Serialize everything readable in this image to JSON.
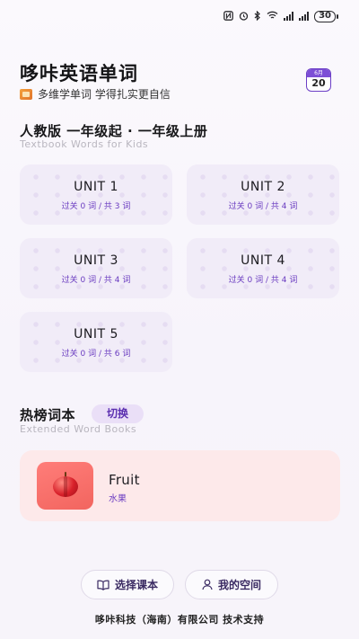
{
  "status_bar": {
    "battery": "30",
    "icons": [
      "nfc-icon",
      "alarm-icon",
      "bluetooth-icon",
      "wifi-icon",
      "signal-icon",
      "signal-icon"
    ]
  },
  "header": {
    "title": "哆咔英语单词",
    "subtitle": "多维学单词 学得扎实更自信",
    "calendar": {
      "month": "6月",
      "day": "20"
    }
  },
  "textbook": {
    "title": "人教版 一年级起 · 一年级上册",
    "subtitle": "Textbook Words for Kids",
    "units": [
      {
        "name": "UNIT 1",
        "progress": "过关 0 词 / 共 3 词"
      },
      {
        "name": "UNIT 2",
        "progress": "过关 0 词 / 共 4 词"
      },
      {
        "name": "UNIT 3",
        "progress": "过关 0 词 / 共 4 词"
      },
      {
        "name": "UNIT 4",
        "progress": "过关 0 词 / 共 4 词"
      },
      {
        "name": "UNIT 5",
        "progress": "过关 0 词 / 共 6 词"
      }
    ]
  },
  "hot_books": {
    "title": "热榜词本",
    "switch_label": "切换",
    "subtitle": "Extended Word Books",
    "book": {
      "name": "Fruit",
      "translation": "水果",
      "icon": "apple-icon"
    }
  },
  "actions": {
    "choose_book": "选择课本",
    "my_space": "我的空间"
  },
  "footer": "哆咔科技（海南）有限公司 技术支持",
  "colors": {
    "accent": "#6a3cc0",
    "unit_card_bg": "#f1ecf8",
    "book_card_bg": "#fde9ea",
    "fruit_tile": "#f2655f"
  }
}
